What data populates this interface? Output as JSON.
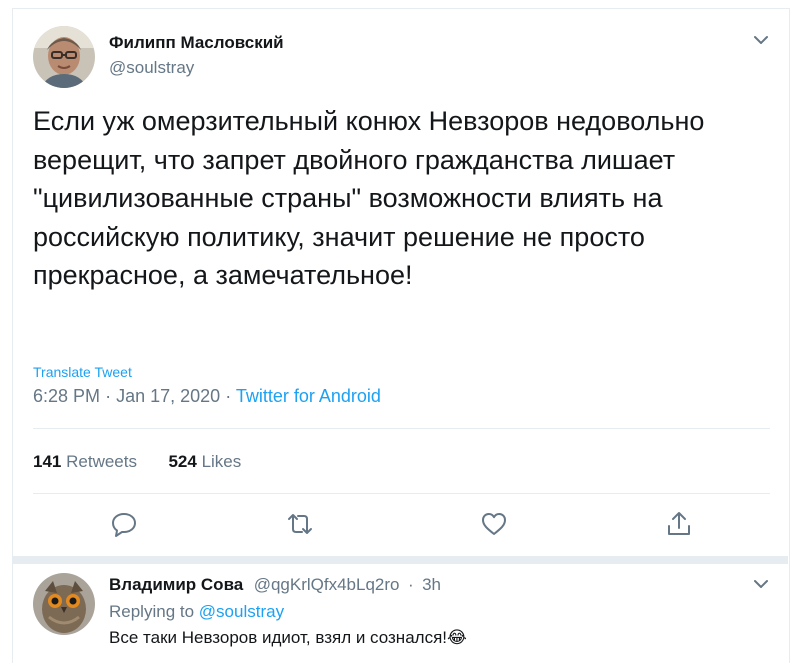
{
  "tweet": {
    "author_name": "Филипп Масловский",
    "author_handle": "@soulstray",
    "text": "Если уж омерзительный конюх Невзоров недовольно верещит, что запрет двойного гражданства лишает \"цивилизованные страны\" возможности влиять на российскую политику, значит решение не просто прекрасное, а замечательное!",
    "translate_label": "Translate Tweet",
    "time": "6:28 PM",
    "date": "Jan 17, 2020",
    "separator": "·",
    "source": "Twitter for Android",
    "retweets_count": "141",
    "retweets_label": "Retweets",
    "likes_count": "524",
    "likes_label": "Likes",
    "icons": [
      "chevron-down-icon",
      "reply-icon",
      "retweet-icon",
      "like-icon",
      "share-icon"
    ]
  },
  "reply": {
    "author_name": "Владимир Сова",
    "author_handle": "@qgKrlQfx4bLq2ro",
    "separator": "·",
    "age": "3h",
    "replying_to_label": "Replying to",
    "replying_to_handle": "@soulstray",
    "text": "Все таки Невзоров идиот, взял и сознался!",
    "emoji": "😂"
  },
  "colors": {
    "accent": "#1da1f2",
    "secondary_text": "#657786",
    "primary_text": "#14171a",
    "divider": "#e6ecf0"
  }
}
